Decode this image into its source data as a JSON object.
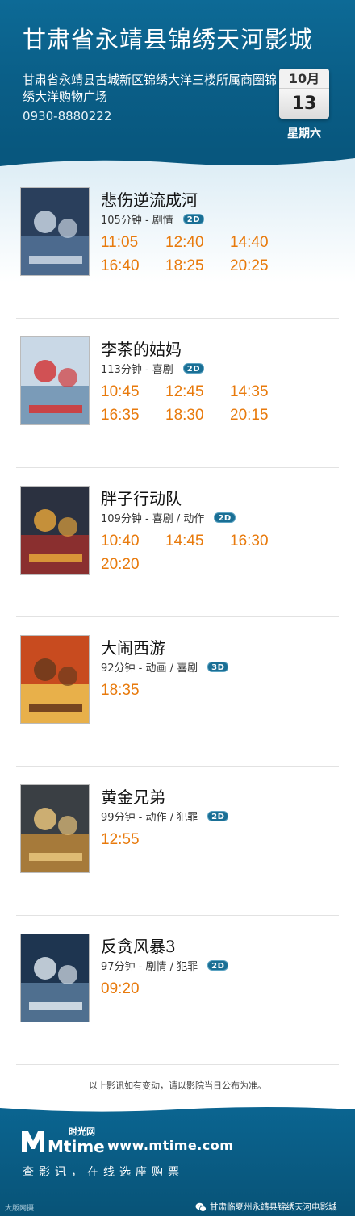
{
  "header": {
    "cinema_name": "甘肃省永靖县锦绣天河影城",
    "address": "甘肃省永靖县古城新区锦绣大洋三楼所属商圈锦绣大洋购物广场",
    "phone": "0930-8880222",
    "date": {
      "month": "10月",
      "day": "13",
      "weekday": "星期六"
    }
  },
  "colors": {
    "header_bg": "#0a5e87",
    "showtime": "#e87a0c",
    "badge": "#1a6f95"
  },
  "movies": [
    {
      "title": "悲伤逆流成河",
      "meta": "105分钟 - 剧情",
      "format": "2D",
      "poster_icon": "movie-poster",
      "showtimes": [
        "11:05",
        "12:40",
        "14:40",
        "16:40",
        "18:25",
        "20:25"
      ]
    },
    {
      "title": "李茶的姑妈",
      "meta": "113分钟 - 喜剧",
      "format": "2D",
      "poster_icon": "movie-poster",
      "showtimes": [
        "10:45",
        "12:45",
        "14:35",
        "16:35",
        "18:30",
        "20:15"
      ]
    },
    {
      "title": "胖子行动队",
      "meta": "109分钟 - 喜剧 / 动作",
      "format": "2D",
      "poster_icon": "movie-poster",
      "showtimes": [
        "10:40",
        "14:45",
        "16:30",
        "20:20"
      ]
    },
    {
      "title": "大闹西游",
      "meta": "92分钟 - 动画 / 喜剧",
      "format": "3D",
      "poster_icon": "movie-poster",
      "showtimes": [
        "18:35"
      ]
    },
    {
      "title": "黄金兄弟",
      "meta": "99分钟 - 动作 / 犯罪",
      "format": "2D",
      "poster_icon": "movie-poster",
      "showtimes": [
        "12:55"
      ]
    },
    {
      "title": "反贪风暴3",
      "meta": "97分钟 - 剧情 / 犯罪",
      "format": "2D",
      "poster_icon": "movie-poster",
      "showtimes": [
        "09:20"
      ]
    }
  ],
  "notice": "以上影讯如有变动，请以影院当日公布为准。",
  "footer": {
    "logo_text": "时光网",
    "logo_word": "Mtime",
    "url": "www.mtime.com",
    "slogan": "查影讯，在线选座购票",
    "watermark": "大版网摄",
    "wechat_icon": "wechat-icon",
    "wechat_account": "甘肃临夏州永靖县锦绣天河电影城"
  }
}
